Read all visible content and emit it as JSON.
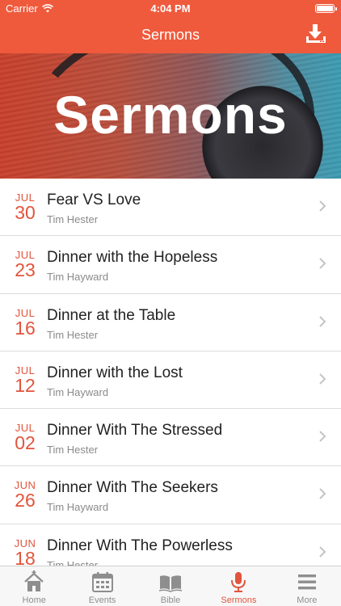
{
  "status_bar": {
    "carrier": "Carrier",
    "time": "4:04 PM"
  },
  "nav": {
    "title": "Sermons",
    "download_icon": "download-icon"
  },
  "hero": {
    "title": "Sermons"
  },
  "sermons": [
    {
      "month": "JUL",
      "day": "30",
      "title": "Fear VS Love",
      "speaker": "Tim Hester"
    },
    {
      "month": "JUL",
      "day": "23",
      "title": "Dinner with the Hopeless",
      "speaker": "Tim Hayward"
    },
    {
      "month": "JUL",
      "day": "16",
      "title": "Dinner at the Table",
      "speaker": "Tim Hester"
    },
    {
      "month": "JUL",
      "day": "12",
      "title": "Dinner with the Lost",
      "speaker": "Tim Hayward"
    },
    {
      "month": "JUL",
      "day": "02",
      "title": "Dinner With The Stressed",
      "speaker": "Tim Hester"
    },
    {
      "month": "JUN",
      "day": "26",
      "title": "Dinner With The Seekers",
      "speaker": "Tim Hayward"
    },
    {
      "month": "JUN",
      "day": "18",
      "title": "Dinner With The Powerless",
      "speaker": "Tim Hester"
    }
  ],
  "tabs": [
    {
      "label": "Home",
      "icon": "home-icon"
    },
    {
      "label": "Events",
      "icon": "calendar-icon"
    },
    {
      "label": "Bible",
      "icon": "book-icon"
    },
    {
      "label": "Sermons",
      "icon": "microphone-icon",
      "active": true
    },
    {
      "label": "More",
      "icon": "menu-icon"
    }
  ],
  "colors": {
    "accent": "#ef5a3c",
    "date_text": "#e2543c",
    "tab_inactive": "#8e8e8e"
  }
}
